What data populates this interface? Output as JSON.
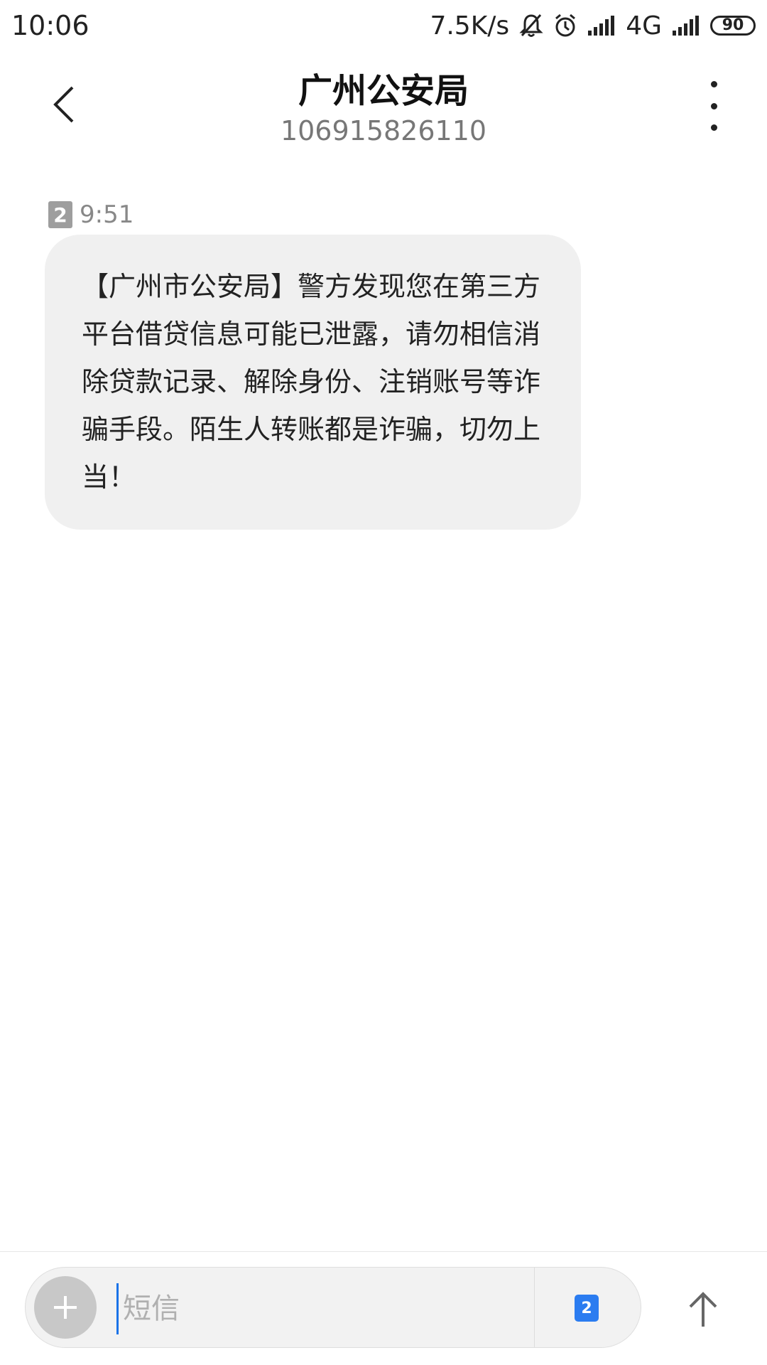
{
  "status_bar": {
    "time": "10:06",
    "net_speed": "7.5K/s",
    "network": "4G",
    "battery": "90",
    "icons": [
      "mute-icon",
      "alarm-icon",
      "signal-icon",
      "signal-icon"
    ]
  },
  "header": {
    "contact_name": "广州公安局",
    "contact_number": "106915826110"
  },
  "message": {
    "sim": "2",
    "time": "9:51",
    "text": "【广州市公安局】警方发现您在第三方平台借贷信息可能已泄露，请勿相信消除贷款记录、解除身份、注销账号等诈骗手段。陌生人转账都是诈骗，切勿上当！"
  },
  "composer": {
    "placeholder": "短信",
    "sim": "2"
  },
  "colors": {
    "bubble": "#f0f0f0",
    "sim_accent": "#2b7cf0",
    "cursor": "#1a73e8"
  }
}
